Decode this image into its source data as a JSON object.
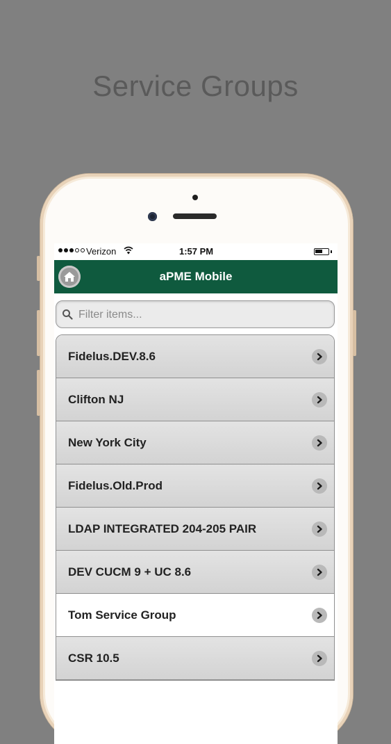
{
  "page_title": "Service Groups",
  "status_bar": {
    "carrier": "Verizon",
    "time": "1:57 PM",
    "signal_bars": 3,
    "signal_total": 5,
    "battery_level": 0.6
  },
  "nav": {
    "title": "aPME Mobile",
    "home_icon": "home-icon"
  },
  "filter": {
    "placeholder": "Filter items...",
    "value": ""
  },
  "items": [
    {
      "label": "Fidelus.DEV.8.6",
      "selected": false
    },
    {
      "label": "Clifton NJ",
      "selected": false
    },
    {
      "label": "New York City",
      "selected": false
    },
    {
      "label": "Fidelus.Old.Prod",
      "selected": false
    },
    {
      "label": "LDAP INTEGRATED 204-205 PAIR",
      "selected": false
    },
    {
      "label": "DEV CUCM 9 + UC 8.6",
      "selected": false
    },
    {
      "label": "Tom Service Group",
      "selected": true
    },
    {
      "label": "CSR 10.5",
      "selected": false
    }
  ],
  "colors": {
    "navbar": "#0f5a3e",
    "background": "#808080",
    "phone_frame": "#e8d2b8"
  }
}
